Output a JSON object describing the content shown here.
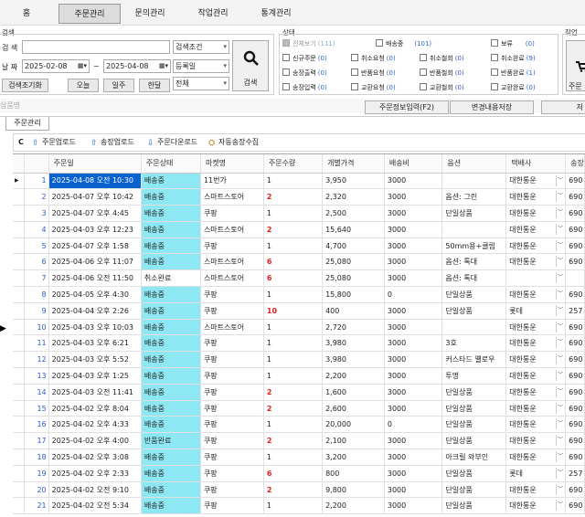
{
  "menu": [
    "홈",
    "주문관리",
    "문의관리",
    "작업관리",
    "통계관리"
  ],
  "search": {
    "group_label": "검색",
    "keyword_label": "검 색",
    "date_label": "날 짜",
    "date_from": "2025-02-08",
    "date_to": "2025-04-08",
    "tilde": "~",
    "cond_select": "검색조건",
    "date_type_select": "등록일",
    "all_select": "전체",
    "search_button": "검색",
    "reset_button": "검색조기화",
    "today_button": "오늘",
    "week_button": "일주",
    "month_button": "한달"
  },
  "status": {
    "group_label": "상태",
    "items": [
      {
        "label": "전체보기",
        "count": "(111)",
        "disabled": true
      },
      {
        "label": "배송중",
        "count": "(101)"
      },
      {
        "label": "보류",
        "count": "(0)"
      },
      {
        "label": "신규주문",
        "count": "(0)"
      },
      {
        "label": "취소요청",
        "count": "(0)"
      },
      {
        "label": "취소철회",
        "count": "(0)"
      },
      {
        "label": "취소완료",
        "count": "(9)"
      },
      {
        "label": "송장출력",
        "count": "(0)"
      },
      {
        "label": "반품요청",
        "count": "(0)"
      },
      {
        "label": "반품철회",
        "count": "(0)"
      },
      {
        "label": "반품완료",
        "count": "(1)"
      },
      {
        "label": "송장입력",
        "count": "(0)"
      },
      {
        "label": "교환요청",
        "count": "(0)"
      },
      {
        "label": "교환철회",
        "count": "(0)"
      },
      {
        "label": "교환완료",
        "count": "(0)"
      }
    ]
  },
  "work": {
    "label": "작업",
    "button": "주문"
  },
  "side_label": "상품명",
  "mid_buttons": {
    "order_info": "주문정보입력(F2)",
    "save_changes": "변경내용저장",
    "right_cut": "저"
  },
  "tab_label": "주문관리",
  "toolbar": {
    "refresh": "C",
    "order_upload": "주문업로드",
    "invoice_upload": "송장업로드",
    "order_download": "주문다운로드",
    "auto_invoice": "자동송장수집"
  },
  "columns": [
    "주문일",
    "주문상태",
    "마켓명",
    "주문수량",
    "개별가격",
    "배송비",
    "옵션",
    "택배사",
    "송장"
  ],
  "rows": [
    [
      "1",
      "2025-04-08 오전 10:30",
      "배송중",
      "11번가",
      "1",
      "3,950",
      "3000",
      "",
      "대한통운",
      "690"
    ],
    [
      "2",
      "2025-04-07 오후 10:42",
      "배송중",
      "스마트스토어",
      "2",
      "2,320",
      "3000",
      "옵션: 그린",
      "대한통운",
      "690"
    ],
    [
      "3",
      "2025-04-07 오후 4:45",
      "배송중",
      "쿠팡",
      "1",
      "2,500",
      "3000",
      "단일상품",
      "대한통운",
      "690"
    ],
    [
      "4",
      "2025-04-03 오후 12:23",
      "배송중",
      "스마트스토어",
      "2",
      "15,640",
      "3000",
      "",
      "대한통운",
      "690"
    ],
    [
      "5",
      "2025-04-07 오후 1:58",
      "배송중",
      "쿠팡",
      "1",
      "4,700",
      "3000",
      "50mm용+클립",
      "대한통운",
      "690"
    ],
    [
      "6",
      "2025-04-06 오후 11:07",
      "배송중",
      "스마트스토어",
      "6",
      "25,080",
      "3000",
      "옵션: 톡대",
      "대한통운",
      "690"
    ],
    [
      "7",
      "2025-04-06 오전 11:50",
      "취소완료",
      "스마트스토어",
      "6",
      "25,080",
      "3000",
      "옵션: 톡대",
      "",
      ""
    ],
    [
      "8",
      "2025-04-05 오후 4:30",
      "배송중",
      "쿠팡",
      "1",
      "15,800",
      "0",
      "단일상품",
      "대한통운",
      "690"
    ],
    [
      "9",
      "2025-04-04 오후 2:26",
      "배송중",
      "쿠팡",
      "10",
      "400",
      "3000",
      "단일상품",
      "롯데",
      "257"
    ],
    [
      "10",
      "2025-04-03 오후 10:03",
      "배송중",
      "스마트스토어",
      "1",
      "2,720",
      "3000",
      "",
      "대한통운",
      "690"
    ],
    [
      "11",
      "2025-04-03 오후 6:21",
      "배송중",
      "쿠팡",
      "1",
      "3,980",
      "3000",
      "3호",
      "대한통운",
      "690"
    ],
    [
      "12",
      "2025-04-03 오후 5:52",
      "배송중",
      "쿠팡",
      "1",
      "3,980",
      "3000",
      "커스타드 옐로우",
      "대한통운",
      "690"
    ],
    [
      "13",
      "2025-04-03 오후 1:25",
      "배송중",
      "쿠팡",
      "1",
      "2,200",
      "3000",
      "투명",
      "대한통운",
      "690"
    ],
    [
      "14",
      "2025-04-03 오전 11:41",
      "배송중",
      "쿠팡",
      "2",
      "1,600",
      "3000",
      "단일상품",
      "대한통운",
      "690"
    ],
    [
      "15",
      "2025-04-02 오후 8:04",
      "배송중",
      "쿠팡",
      "2",
      "2,600",
      "3000",
      "단일상품",
      "대한통운",
      "690"
    ],
    [
      "16",
      "2025-04-02 오후 4:33",
      "배송중",
      "쿠팡",
      "1",
      "20,000",
      "0",
      "단일상품",
      "대한통운",
      "690"
    ],
    [
      "17",
      "2025-04-02 오후 4:00",
      "반품완료",
      "쿠팡",
      "2",
      "2,100",
      "3000",
      "단일상품",
      "대한통운",
      "690"
    ],
    [
      "18",
      "2025-04-02 오후 3:08",
      "배송중",
      "쿠팡",
      "1",
      "3,200",
      "3000",
      "아크릴 와부인",
      "대한통운",
      "690"
    ],
    [
      "19",
      "2025-04-02 오후 2:33",
      "배송중",
      "쿠팡",
      "6",
      "800",
      "3000",
      "단일상품",
      "롯데",
      "257"
    ],
    [
      "20",
      "2025-04-02 오전 9:10",
      "배송중",
      "쿠팡",
      "2",
      "9,800",
      "3000",
      "단일상품",
      "대한통운",
      "690"
    ],
    [
      "21",
      "2025-04-02 오전 5:34",
      "배송중",
      "쿠팡",
      "1",
      "2,200",
      "3000",
      "단일상품",
      "대한통운",
      "690"
    ]
  ],
  "colors": {
    "status_cell": "#8ee8f3",
    "selected": "#0a62cf",
    "qty_red": "#e02020",
    "count_blue": "#2d5ec9"
  }
}
